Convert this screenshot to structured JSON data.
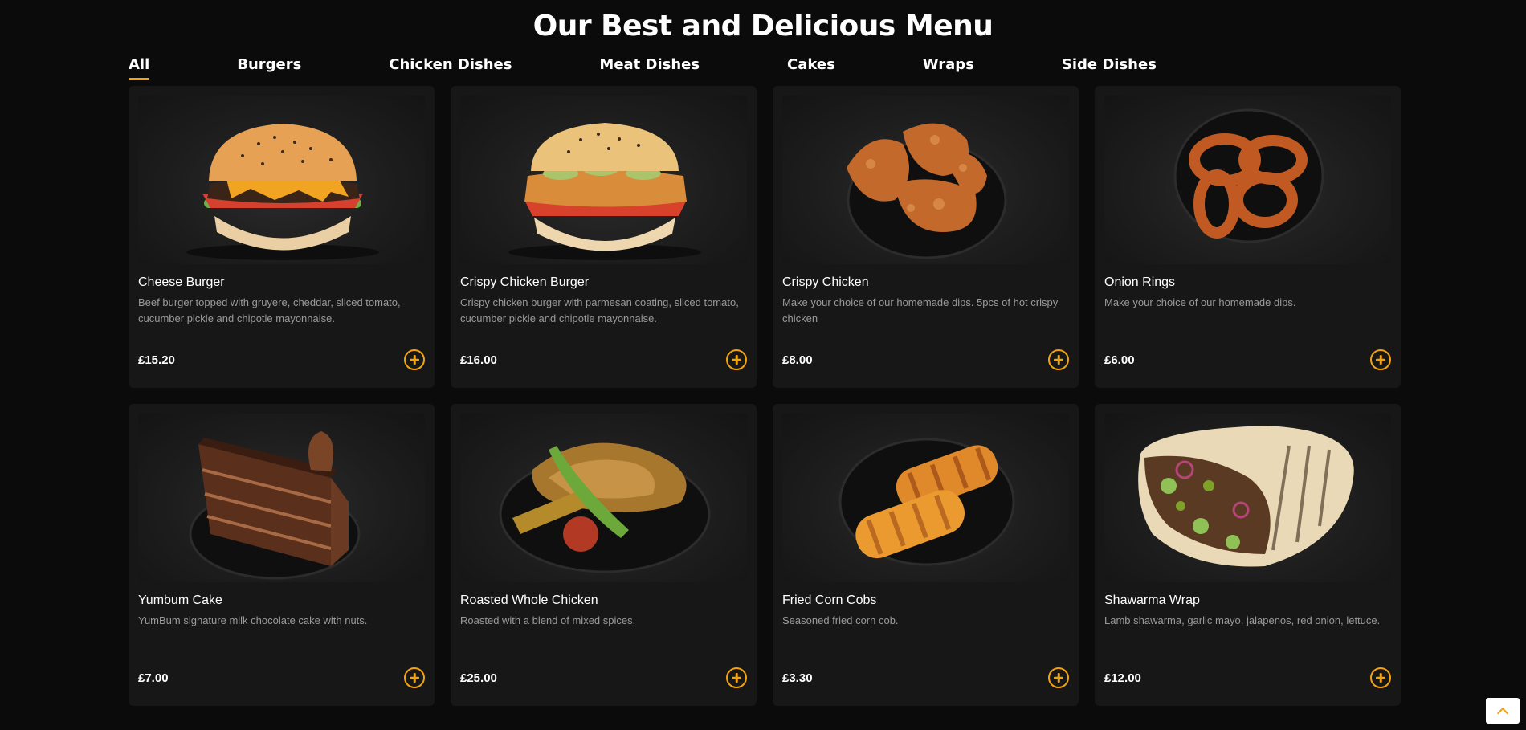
{
  "page": {
    "title": "Our Best and Delicious Menu"
  },
  "tabs": [
    {
      "label": "All",
      "active": true
    },
    {
      "label": "Burgers",
      "active": false
    },
    {
      "label": "Chicken Dishes",
      "active": false
    },
    {
      "label": "Meat Dishes",
      "active": false
    },
    {
      "label": "Cakes",
      "active": false
    },
    {
      "label": "Wraps",
      "active": false
    },
    {
      "label": "Side Dishes",
      "active": false
    }
  ],
  "theme": {
    "accent": "#f2a30f",
    "card_bg": "#171717",
    "page_bg": "#0b0b0b"
  },
  "items": [
    {
      "name": "Cheese Burger",
      "description": "Beef burger topped with gruyere, cheddar, sliced tomato, cucumber pickle and chipotle mayonnaise.",
      "price": "£15.20",
      "image_icon": "cheese-burger-image"
    },
    {
      "name": "Crispy Chicken Burger",
      "description": "Crispy chicken burger with parmesan coating, sliced tomato, cucumber pickle and chipotle mayonnaise.",
      "price": "£16.00",
      "image_icon": "chicken-burger-image"
    },
    {
      "name": "Crispy Chicken",
      "description": "Make your choice of our homemade dips. 5pcs of hot crispy chicken",
      "price": "£8.00",
      "image_icon": "crispy-chicken-image"
    },
    {
      "name": "Onion Rings",
      "description": "Make your choice of our homemade dips.",
      "price": "£6.00",
      "image_icon": "onion-rings-image"
    },
    {
      "name": "Yumbum Cake",
      "description": "YumBum signature milk chocolate cake with nuts.",
      "price": "£7.00",
      "image_icon": "chocolate-cake-image"
    },
    {
      "name": "Roasted Whole Chicken",
      "description": "Roasted with a blend of mixed spices.",
      "price": "£25.00",
      "image_icon": "roasted-chicken-image"
    },
    {
      "name": "Fried Corn Cobs",
      "description": "Seasoned fried corn cob.",
      "price": "£3.30",
      "image_icon": "corn-cobs-image"
    },
    {
      "name": "Shawarma Wrap",
      "description": "Lamb shawarma, garlic mayo, jalapenos, red onion, lettuce.",
      "price": "£12.00",
      "image_icon": "shawarma-wrap-image"
    }
  ],
  "scroll_top": {
    "icon": "chevron-up-icon"
  }
}
